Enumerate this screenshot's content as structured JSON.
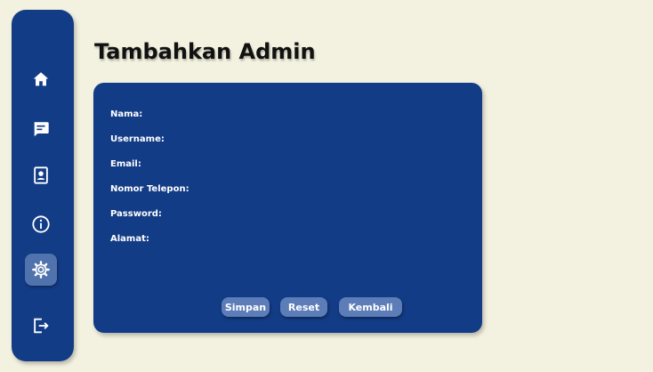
{
  "sidebar": {
    "items": [
      {
        "icon": "home-icon"
      },
      {
        "icon": "chat-icon"
      },
      {
        "icon": "contact-book-icon"
      },
      {
        "icon": "info-icon"
      },
      {
        "icon": "gear-icon",
        "active": true
      },
      {
        "icon": "logout-icon"
      }
    ]
  },
  "page": {
    "title": "Tambahkan Admin"
  },
  "form": {
    "fields": [
      {
        "label": "Nama:",
        "value": ""
      },
      {
        "label": "Username:",
        "value": ""
      },
      {
        "label": "Email:",
        "value": ""
      },
      {
        "label": "Nomor Telepon:",
        "value": ""
      },
      {
        "label": "Password:",
        "value": ""
      },
      {
        "label": "Alamat:",
        "value": ""
      }
    ],
    "buttons": {
      "save": "Simpan",
      "reset": "Reset",
      "back": "Kembali"
    }
  },
  "colors": {
    "background": "#f3f1df",
    "primary": "#133c87",
    "button": "#5c7db8",
    "active_nav": "#5173ad"
  }
}
